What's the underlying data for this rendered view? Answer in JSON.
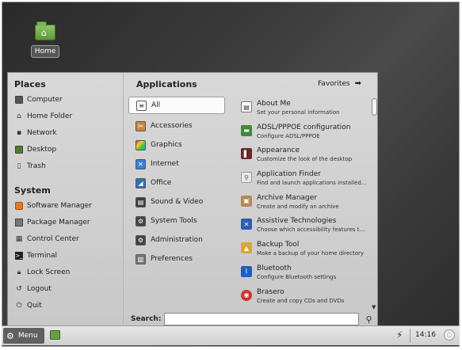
{
  "desktop": {
    "icons": [
      {
        "label": "Home",
        "icon": "home-folder-icon"
      }
    ]
  },
  "menu": {
    "places": {
      "title": "Places",
      "items": [
        {
          "label": "Computer",
          "icon": "computer-icon"
        },
        {
          "label": "Home Folder",
          "icon": "home-icon"
        },
        {
          "label": "Network",
          "icon": "network-icon"
        },
        {
          "label": "Desktop",
          "icon": "desktop-icon"
        },
        {
          "label": "Trash",
          "icon": "trash-icon"
        }
      ]
    },
    "system": {
      "title": "System",
      "items": [
        {
          "label": "Software Manager",
          "icon": "software-manager-icon"
        },
        {
          "label": "Package Manager",
          "icon": "package-manager-icon"
        },
        {
          "label": "Control Center",
          "icon": "control-center-icon"
        },
        {
          "label": "Terminal",
          "icon": "terminal-icon"
        },
        {
          "label": "Lock Screen",
          "icon": "lock-icon"
        },
        {
          "label": "Logout",
          "icon": "logout-icon"
        },
        {
          "label": "Quit",
          "icon": "quit-icon"
        }
      ]
    },
    "applications": {
      "title": "Applications",
      "favorites_label": "Favorites",
      "categories": [
        {
          "label": "All",
          "selected": true
        },
        {
          "label": "Accessories"
        },
        {
          "label": "Graphics"
        },
        {
          "label": "Internet"
        },
        {
          "label": "Office"
        },
        {
          "label": "Sound & Video"
        },
        {
          "label": "System Tools"
        },
        {
          "label": "Administration"
        },
        {
          "label": "Preferences"
        }
      ],
      "apps": [
        {
          "name": "About Me",
          "desc": "Set your personal information"
        },
        {
          "name": "ADSL/PPPOE configuration",
          "desc": "Configure ADSL/PPPOE"
        },
        {
          "name": "Appearance",
          "desc": "Customize the look of the desktop"
        },
        {
          "name": "Application Finder",
          "desc": "Find and launch applications installed..."
        },
        {
          "name": "Archive Manager",
          "desc": "Create and modify an archive"
        },
        {
          "name": "Assistive Technologies",
          "desc": "Choose which accessibility features t..."
        },
        {
          "name": "Backup Tool",
          "desc": "Make a backup of your home directory"
        },
        {
          "name": "Bluetooth",
          "desc": "Configure Bluetooth settings"
        },
        {
          "name": "Brasero",
          "desc": "Create and copy CDs and DVDs"
        }
      ]
    },
    "search": {
      "label": "Search:",
      "value": ""
    }
  },
  "taskbar": {
    "menu_label": "Menu",
    "clock": "14:16"
  },
  "colors": {
    "menu_bg": "#d3d3d3",
    "taskbar_button": "#606060",
    "accent_green": "#6c9c45"
  }
}
